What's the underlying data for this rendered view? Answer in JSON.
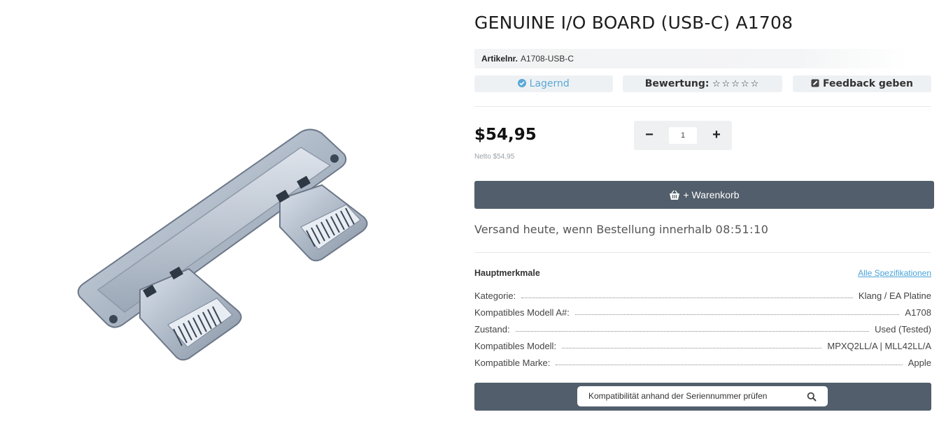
{
  "product": {
    "title": "GENUINE I/O BOARD (USB-C) A1708",
    "sku_label": "Artikelnr.",
    "sku_value": "A1708-USB-C",
    "stock_status": "Lagernd",
    "rating_label": "Bewertung:",
    "rating_stars": "☆☆☆☆☆",
    "rating_value": 0,
    "rating_max": 5,
    "feedback_label": "Feedback geben"
  },
  "pricing": {
    "price": "$54,95",
    "netto": "Netto $54,95"
  },
  "quantity": {
    "minus": "−",
    "value": "1",
    "plus": "+"
  },
  "cart": {
    "label": "+ Warenkorb"
  },
  "shipping": {
    "text": "Versand heute, wenn Bestellung innerhalb",
    "timer": "08:51:10"
  },
  "specs": {
    "heading": "Hauptmerkmale",
    "link": "Alle Spezifikationen",
    "rows": [
      {
        "key": "Kategorie:",
        "value": "Klang / EA Platine"
      },
      {
        "key": "Kompatibles Modell A#:",
        "value": "A1708"
      },
      {
        "key": "Zustand:",
        "value": "Used (Tested)"
      },
      {
        "key": "Kompatibles Modell:",
        "value": "MPXQ2LL/A | MLL42LL/A"
      },
      {
        "key": "Kompatible Marke:",
        "value": "Apple"
      }
    ]
  },
  "serial_check": {
    "placeholder": "Kompatibilität anhand der Seriennummer prüfen"
  },
  "colors": {
    "accent": "#4aa3d9",
    "button_bg": "#525e6b",
    "pill_bg": "#eef1f4"
  }
}
